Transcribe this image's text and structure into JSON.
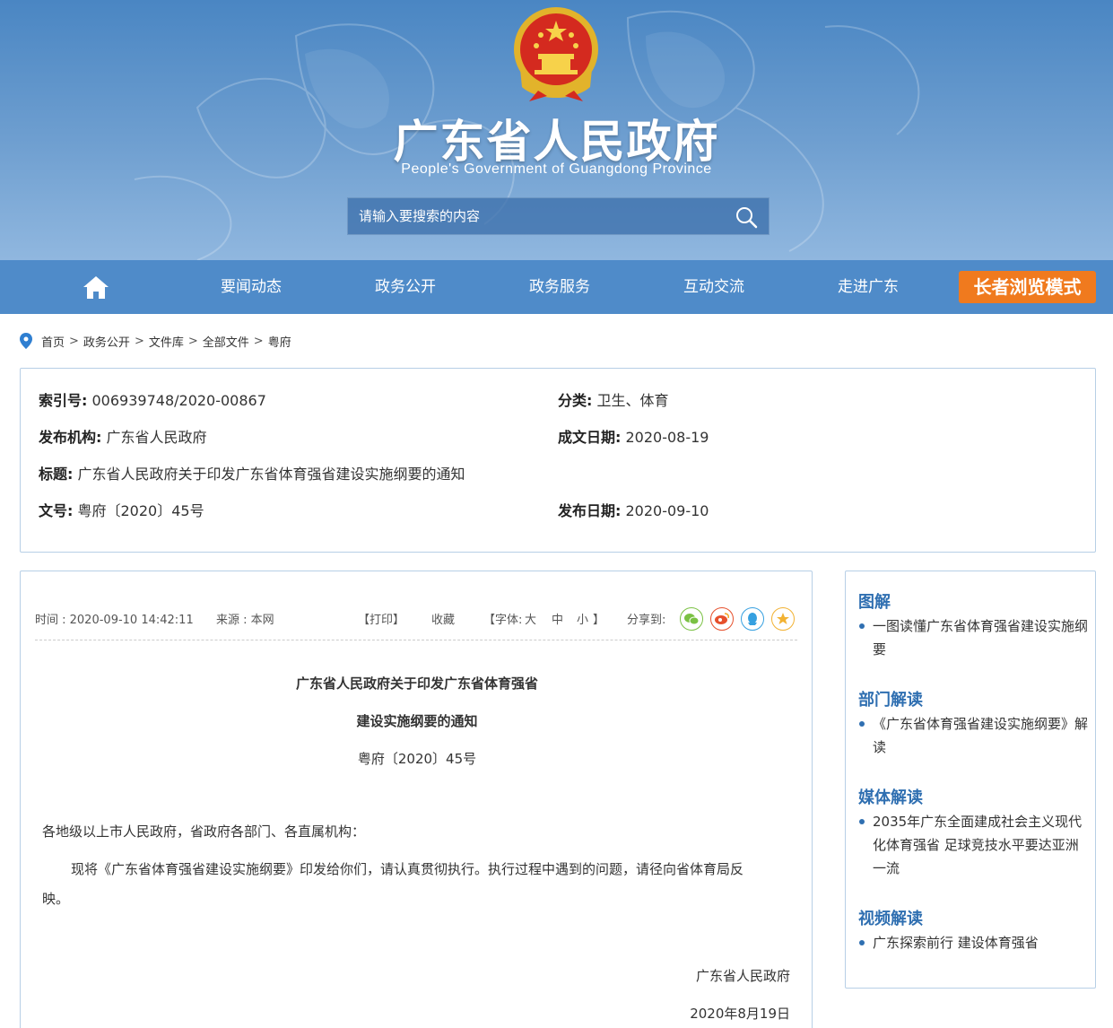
{
  "header": {
    "title": "广东省人民政府",
    "subtitle": "People's Government of Guangdong Province",
    "search_placeholder": "请输入要搜索的内容"
  },
  "nav": {
    "items": [
      "要闻动态",
      "政务公开",
      "政务服务",
      "互动交流",
      "走进广东"
    ],
    "elder_mode": "长者浏览模式"
  },
  "breadcrumb": [
    "首页",
    "政务公开",
    "文件库",
    "全部文件",
    "粤府"
  ],
  "info": {
    "index_label": "索引号:",
    "index_value": "006939748/2020-00867",
    "category_label": "分类:",
    "category_value": "卫生、体育",
    "publisher_label": "发布机构:",
    "publisher_value": "广东省人民政府",
    "written_date_label": "成文日期:",
    "written_date_value": "2020-08-19",
    "title_label": "标题:",
    "title_value": "广东省人民政府关于印发广东省体育强省建设实施纲要的通知",
    "doc_no_label": "文号:",
    "doc_no_value": "粤府〔2020〕45号",
    "publish_date_label": "发布日期:",
    "publish_date_value": "2020-09-10"
  },
  "article": {
    "time": "时间 : 2020-09-10 14:42:11",
    "source": "来源 : 本网",
    "print": "【打印】",
    "favorite": "收藏",
    "font_label": "【字体:",
    "font_large": "大",
    "font_medium": "中",
    "font_small": "小",
    "font_close": "】",
    "share_label": "分享到:",
    "title_line1": "广东省人民政府关于印发广东省体育强省",
    "title_line2": "建设实施纲要的通知",
    "doc_no": "粤府〔2020〕45号",
    "salutation": "各地级以上市人民政府，省政府各部门、各直属机构：",
    "body_line1": "现将《广东省体育强省建设实施纲要》印发给你们，请认真贯彻执行。执行过程中遇到的问题，请径向省体育局反",
    "body_line2": "映。",
    "signature": "广东省人民政府",
    "date": "2020年8月19日"
  },
  "sidebar": {
    "sections": [
      {
        "title": "图解",
        "items": [
          "一图读懂广东省体育强省建设实施纲要"
        ]
      },
      {
        "title": "部门解读",
        "items": [
          "《广东省体育强省建设实施纲要》解读"
        ]
      },
      {
        "title": "媒体解读",
        "items": [
          "2035年广东全面建成社会主义现代化体育强省 足球竞技水平要达亚洲一流"
        ]
      },
      {
        "title": "视频解读",
        "items": [
          "广东探索前行 建设体育强省"
        ]
      }
    ]
  },
  "icons": {
    "wechat": "wechat-icon",
    "weibo": "weibo-icon",
    "qq": "qq-icon",
    "qzone": "qzone-icon"
  },
  "colors": {
    "banner": "#4a86c3",
    "nav": "#4f8bc9",
    "elder_button": "#f07a1e",
    "accent": "#2f6fb1",
    "border": "#b7cfe6"
  }
}
